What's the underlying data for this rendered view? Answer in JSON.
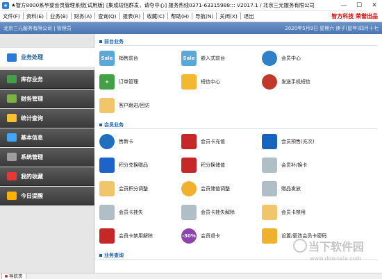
{
  "window": {
    "title": "★智方8000系孕婴会员管理系统[试用版] [集成短信群发，请夺中心] 服务热线0371-63315988::: V2017.1 / 北京三元服务有限公司"
  },
  "menu": {
    "items": [
      "文件(F)",
      "资料(E)",
      "业务(B)",
      "财务(A)",
      "查询(Q)",
      "报表(R)",
      "收藏(C)",
      "帮助(H)",
      "导航(N)",
      "关闭(X)",
      "退出"
    ],
    "brand": "智方科技 荣誉出品"
  },
  "infobar": {
    "company": "北京三元服务有限公司 | 管理员",
    "date": "2020年5月9日  星期六  庚子(鼠年)四月十七"
  },
  "sidebar": {
    "items": [
      {
        "label": "业务处理",
        "icon": "business-icon",
        "color": "#2a7bd6",
        "active": true
      },
      {
        "label": "库存业务",
        "icon": "inventory-icon",
        "color": "#43a047"
      },
      {
        "label": "财务管理",
        "icon": "finance-icon",
        "color": "#7cb342"
      },
      {
        "label": "统计查询",
        "icon": "statistics-icon",
        "color": "#fbc02d"
      },
      {
        "label": "基本信息",
        "icon": "info-icon",
        "color": "#42a5f5"
      },
      {
        "label": "系统管理",
        "icon": "system-icon",
        "color": "#9e9e9e"
      },
      {
        "label": "我的收藏",
        "icon": "favorites-icon",
        "color": "#e53935"
      },
      {
        "label": "今日提醒",
        "icon": "reminder-icon",
        "color": "#ffb300"
      }
    ]
  },
  "sections": [
    {
      "title": "前台业务"
    },
    {
      "title": "会员业务"
    },
    {
      "title": "业务查询"
    }
  ],
  "tiles": [
    {
      "label": "销售前台",
      "icon": "sale-icon",
      "color": "#5ba7d9",
      "text": "Sale"
    },
    {
      "label": "嵌入式前台",
      "icon": "sale-icon",
      "color": "#5ba7d9",
      "text": "Sale"
    },
    {
      "label": "会员中心",
      "icon": "members-icon",
      "color": "#2f7fc9"
    },
    {
      "label": "订单管理",
      "icon": "plus-icon",
      "color": "#43a047",
      "text": "+"
    },
    {
      "label": "短信中心",
      "icon": "mail-icon",
      "color": "#f2b830"
    },
    {
      "label": "发送手机短信",
      "icon": "person-icon",
      "color": "#c0392b"
    },
    {
      "label": "客户跟进/回访",
      "icon": "folder-icon",
      "color": "#f1c66a"
    },
    {
      "label": "售新卡",
      "icon": "user-icon",
      "color": "#1f6fbf"
    },
    {
      "label": "会员卡充值",
      "icon": "star-icon",
      "color": "#c62828"
    },
    {
      "label": "会员预售(充次)",
      "icon": "card-icon",
      "color": "#1565c0"
    },
    {
      "label": "积分兑换赠品",
      "icon": "home-icon",
      "color": "#1e64c8"
    },
    {
      "label": "积分换储值",
      "icon": "phone-icon",
      "color": "#c62828"
    },
    {
      "label": "会员补/换卡",
      "icon": "search-doc-icon",
      "color": "#b0bec5"
    },
    {
      "label": "会员积分调整",
      "icon": "folder-icon",
      "color": "#f1c66a"
    },
    {
      "label": "会员储值调整",
      "icon": "clock-icon",
      "color": "#f0b22e"
    },
    {
      "label": "赠品发放",
      "icon": "search-doc-icon",
      "color": "#b0bec5"
    },
    {
      "label": "会员卡挂失",
      "icon": "search-doc-icon",
      "color": "#b0bec5"
    },
    {
      "label": "会员卡挂失解除",
      "icon": "search-doc-icon",
      "color": "#b0bec5"
    },
    {
      "label": "会员卡禁用",
      "icon": "folder-icon",
      "color": "#f1c66a"
    },
    {
      "label": "会员卡禁用解除",
      "icon": "star-icon",
      "color": "#c62828"
    },
    {
      "label": "会员退卡",
      "icon": "discount-icon",
      "color": "#8e44ad",
      "text": "-30%"
    },
    {
      "label": "设置/更改会员卡密码",
      "icon": "chart-icon",
      "color": "#f0b22e"
    }
  ],
  "statusbar": {
    "nav_tab": "导航页"
  },
  "watermark": {
    "title": "当下软件园",
    "url": "www.downxia.com"
  }
}
